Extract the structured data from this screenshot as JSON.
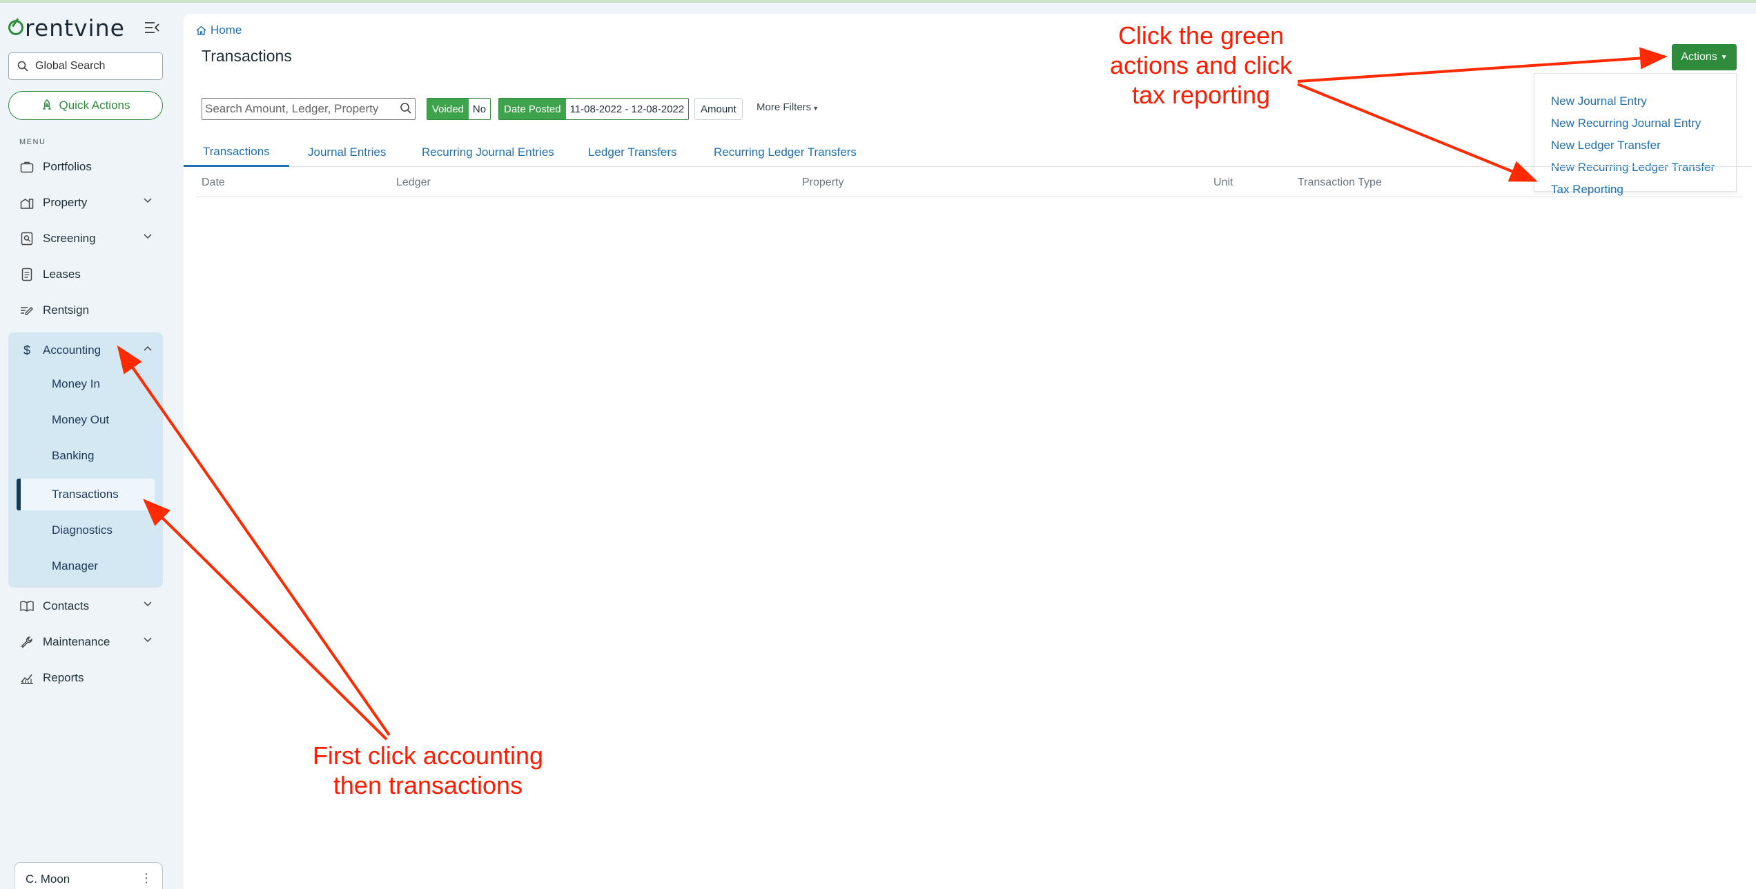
{
  "brand": {
    "name": "rentvine",
    "accent": "#2e8b3c"
  },
  "sidebar": {
    "search_placeholder": "Global Search",
    "quick_actions": "Quick Actions",
    "menu_label": "MENU",
    "items": [
      {
        "label": "Portfolios",
        "icon": "briefcase-icon"
      },
      {
        "label": "Property",
        "icon": "building-icon"
      },
      {
        "label": "Screening",
        "icon": "screening-icon"
      },
      {
        "label": "Leases",
        "icon": "document-icon"
      },
      {
        "label": "Rentsign",
        "icon": "signature-icon"
      },
      {
        "label": "Accounting",
        "icon": "dollar-icon"
      },
      {
        "label": "Contacts",
        "icon": "book-icon"
      },
      {
        "label": "Maintenance",
        "icon": "wrench-icon"
      },
      {
        "label": "Reports",
        "icon": "chart-icon"
      }
    ],
    "accounting_sub": [
      "Money In",
      "Money Out",
      "Banking",
      "Transactions",
      "Diagnostics",
      "Manager"
    ],
    "user": "C. Moon"
  },
  "main": {
    "breadcrumb": "Home",
    "title": "Transactions",
    "actions_label": "Actions",
    "actions_menu": [
      "New Journal Entry",
      "New Recurring Journal Entry",
      "New Ledger Transfer",
      "New Recurring Ledger Transfer",
      "Tax Reporting"
    ],
    "filters": {
      "search_placeholder": "Search Amount, Ledger, Property",
      "voided_label": "Voided",
      "voided_value": "No",
      "date_label": "Date Posted",
      "date_value": "11-08-2022 - 12-08-2022",
      "amount": "Amount",
      "more": "More Filters"
    },
    "tabs": [
      "Transactions",
      "Journal Entries",
      "Recurring Journal Entries",
      "Ledger Transfers",
      "Recurring Ledger Transfers"
    ],
    "columns": [
      "Date",
      "Ledger",
      "Property",
      "Unit",
      "Transaction Type"
    ]
  },
  "annotations": {
    "top": [
      "Click the green",
      "actions and click",
      "tax reporting"
    ],
    "bottom": [
      "First click accounting",
      "then transactions"
    ],
    "color": "#ff1a00"
  }
}
